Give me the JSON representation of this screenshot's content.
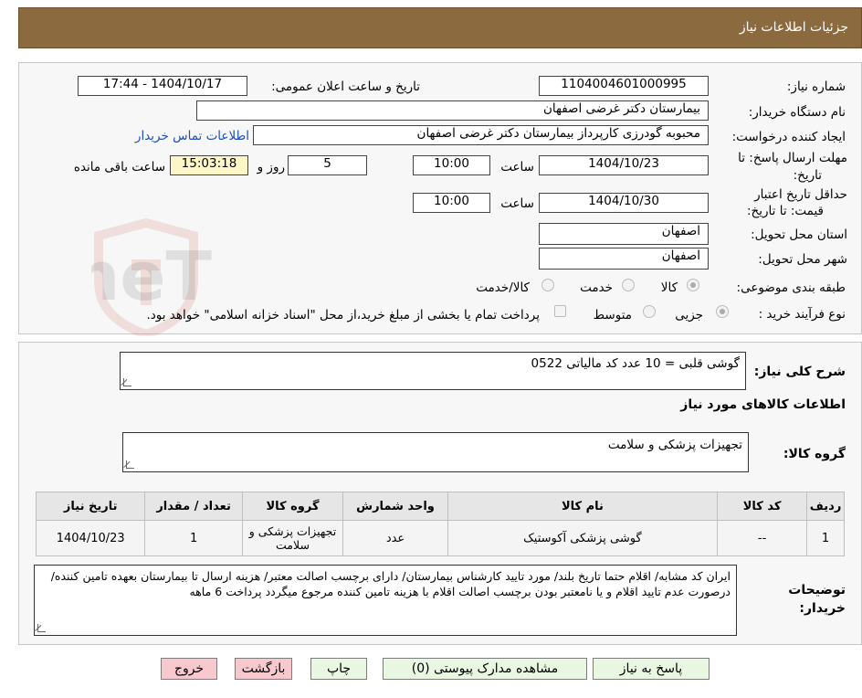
{
  "header": {
    "title": "جزئیات اطلاعات نیاز"
  },
  "watermark": {
    "text": "AriaTender.neT"
  },
  "form": {
    "need_number_label": "شماره نیاز:",
    "need_number": "1104004601000995",
    "announce_label": "تاریخ و ساعت اعلان عمومی:",
    "announce_value": "1404/10/17 - 17:44",
    "buyer_org_label": "نام دستگاه خریدار:",
    "buyer_org": "بیمارستان دکتر غرضی اصفهان",
    "requester_label": "ایجاد کننده درخواست:",
    "requester": "محبوبه گودرزی کارپرداز بیمارستان دکتر غرضی اصفهان",
    "contact_link": "اطلاعات تماس خریدار",
    "deadline_label_1": "مهلت ارسال پاسخ: تا",
    "deadline_label_2": "تاریخ:",
    "deadline_date": "1404/10/23",
    "time_label": "ساعت",
    "deadline_time": "10:00",
    "days_value": "5",
    "days_label": "روز و",
    "remaining_time": "15:03:18",
    "remaining_label": "ساعت باقی مانده",
    "validity_label_1": "حداقل تاریخ اعتبار",
    "validity_label_2": "قیمت: تا تاریخ:",
    "validity_date": "1404/10/30",
    "validity_time": "10:00",
    "province_label": "استان محل تحویل:",
    "province": "اصفهان",
    "city_label": "شهر محل تحویل:",
    "city": "اصفهان",
    "category_label": "طبقه بندی موضوعی:",
    "category_options": [
      "کالا",
      "خدمت",
      "کالا/خدمت"
    ],
    "process_label": "نوع فرآیند خرید :",
    "process_options": [
      "جزیی",
      "متوسط"
    ],
    "payment_note": "پرداخت تمام یا بخشی از مبلغ خرید،از محل \"اسناد خزانه اسلامی\" خواهد بود."
  },
  "summary": {
    "label": "شرح کلی نیاز:",
    "value": "گوشی قلبی = 10 عدد کد مالیاتی 0522",
    "items_title": "اطلاعات کالاهای مورد نیاز",
    "group_label": "گروه کالا:",
    "group_value": "تجهیزات پزشکی و سلامت"
  },
  "table": {
    "headers": [
      "ردیف",
      "کد کالا",
      "نام کالا",
      "واحد شمارش",
      "گروه کالا",
      "تعداد / مقدار",
      "تاریخ نیاز"
    ],
    "rows": [
      [
        "1",
        "--",
        "گوشی پزشکی آکوستیک",
        "عدد",
        "تجهیزات پزشکی و سلامت",
        "1",
        "1404/10/23"
      ]
    ]
  },
  "notes": {
    "label_1": "توضیحات",
    "label_2": "خریدار:",
    "text": "ایران کد مشابه/ اقلام حتما تاریخ بلند/ مورد تایید کارشناس بیمارستان/ دارای برچسب اصالت معتبر/ هزینه ارسال تا بیمارستان بعهده تامین کننده/ درصورت عدم تایید اقلام و یا نامعتبر بودن برچسب اصالت اقلام با هزینه تامین کننده مرجوع میگردد پرداخت  6 ماهه"
  },
  "buttons": {
    "reply": "پاسخ به نیاز",
    "attachments": "مشاهده مدارک پیوستی (0)",
    "print": "چاپ",
    "back": "بازگشت",
    "exit": "خروج"
  }
}
